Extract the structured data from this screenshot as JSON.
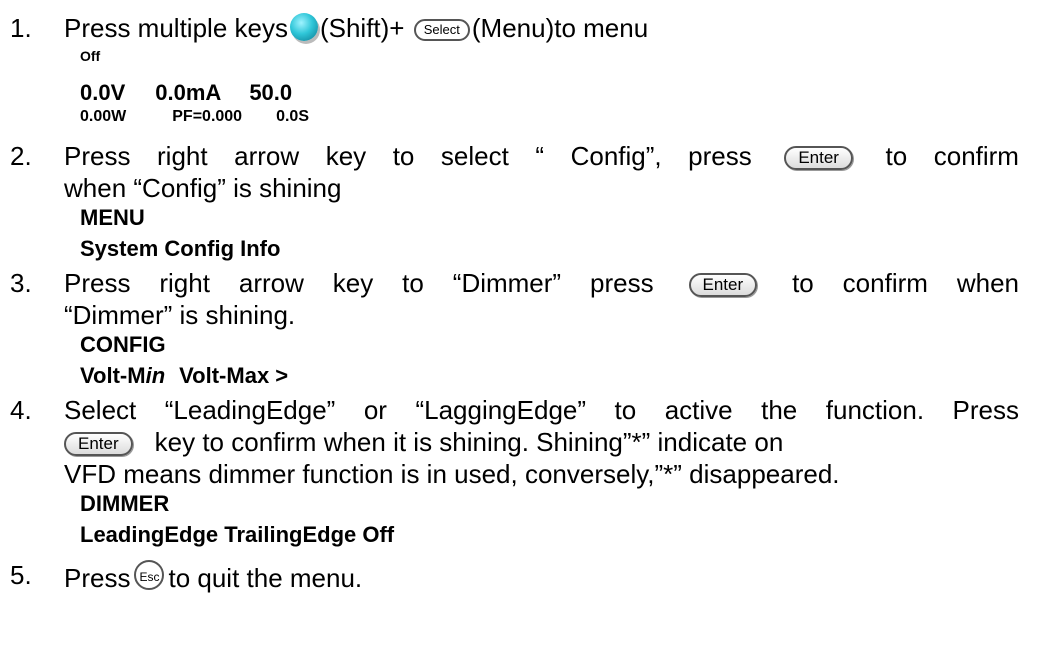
{
  "steps": [
    {
      "number": "1.",
      "text_a": "Press multiple keys",
      "shift_label": "(Shift)+",
      "select_key": "Select",
      "text_b": "(Menu)to menu",
      "display": {
        "status": "Off",
        "voltage": "0.0V",
        "current": "0.0mA",
        "freq": "50.0",
        "power": "0.00W",
        "pf": "PF=0.000",
        "time": "0.0S"
      }
    },
    {
      "number": "2.",
      "text_a": "Press right arrow key to select “ Config”, press",
      "key": "Enter",
      "text_b": "to confirm",
      "text_c": "when “Config” is shining",
      "screen_title": "MENU",
      "screen_items": "System Config Info"
    },
    {
      "number": "3.",
      "text_a": "Press right arrow key to “Dimmer” press",
      "key": "Enter",
      "text_b": "to confirm when",
      "text_c": "“Dimmer” is shining.",
      "screen_title": "CONFIG",
      "screen_item_a_prefix": "Volt-M",
      "screen_item_a_italic": "in",
      "screen_item_b": "Volt-Max >"
    },
    {
      "number": "4.",
      "text_a": "Select “LeadingEdge” or “LaggingEdge” to active the function. Press",
      "key": "Enter",
      "text_b": "key to confirm when it is shining. Shining”*” indicate on",
      "text_c": "VFD means dimmer function is in used, conversely,”*” disappeared.",
      "screen_title": "DIMMER",
      "screen_items": "LeadingEdge TrailingEdge Off"
    },
    {
      "number": "5.",
      "text_a": "Press",
      "esc_key": "Esc",
      "text_b": "to quit the menu."
    }
  ]
}
